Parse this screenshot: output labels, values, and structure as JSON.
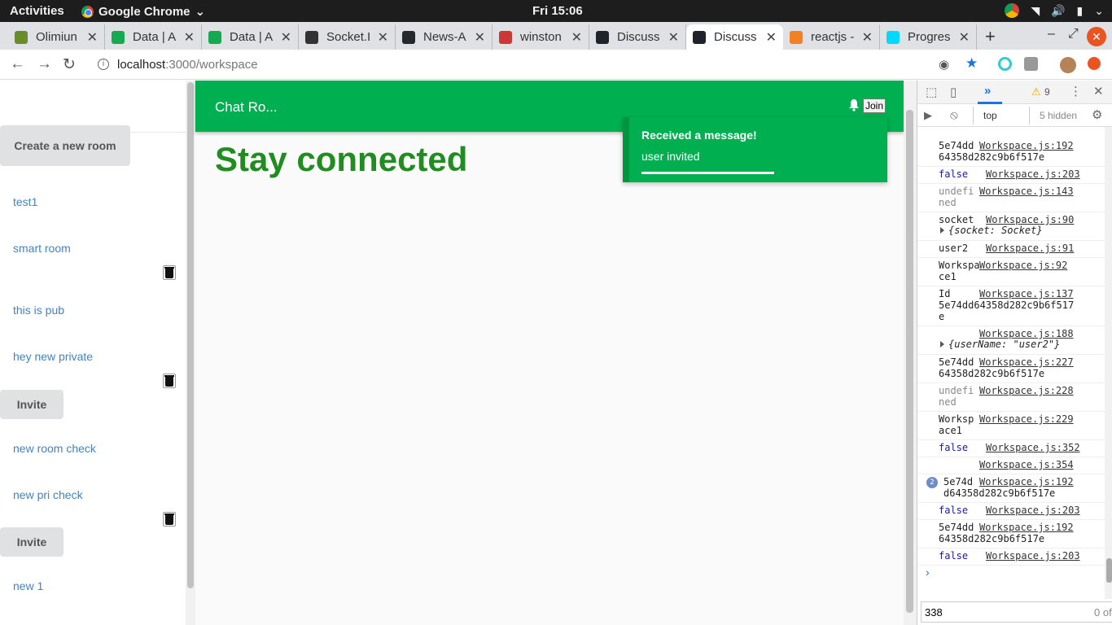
{
  "os_bar": {
    "activities": "Activities",
    "app_name": "Google Chrome",
    "clock": "Fri 15:06"
  },
  "tabs": [
    {
      "title": "Olimiun",
      "color": "#6a8c2b"
    },
    {
      "title": "Data | A",
      "color": "#13aa52"
    },
    {
      "title": "Data | A",
      "color": "#13aa52"
    },
    {
      "title": "Socket.I",
      "color": "#333333"
    },
    {
      "title": "News-A",
      "color": "#24292e"
    },
    {
      "title": "winston",
      "color": "#cb3837"
    },
    {
      "title": "Discuss",
      "color": "#20232a"
    },
    {
      "title": "Discuss",
      "color": "#20232a",
      "active": true
    },
    {
      "title": "reactjs -",
      "color": "#f48024"
    },
    {
      "title": "Progres",
      "color": "#00d8ff"
    }
  ],
  "address": {
    "host": "localhost",
    "path": ":3000/workspace"
  },
  "sidebar": {
    "create_button": "Create a new room",
    "rooms": [
      {
        "name": "test1"
      },
      {
        "name": "smart room"
      },
      {
        "name": "this is pub"
      },
      {
        "name": "hey new private"
      },
      {
        "name": "new room check"
      },
      {
        "name": "new pri check"
      },
      {
        "name": "new 1"
      }
    ],
    "invite_label": "Invite"
  },
  "header": {
    "title": "Chat Ro...",
    "join_label": "Join"
  },
  "main": {
    "headline": "Stay connected"
  },
  "toast": {
    "title": "Received a message!",
    "body": "user invited"
  },
  "devtools": {
    "warnings": "9",
    "context": "top",
    "hidden": "5 hidden",
    "search_value": "338",
    "search_result": "0 of",
    "logs": [
      {
        "msg": "5e74dd\n64358d282c9b6f517e",
        "src": "Workspace.js:192"
      },
      {
        "msg": "false",
        "src": "Workspace.js:203",
        "kw": true
      },
      {
        "msg": "undefi\nned",
        "src": "Workspace.js:143",
        "gray": true
      },
      {
        "msg": "socket",
        "src": "Workspace.js:90",
        "sub": "{socket: Socket}"
      },
      {
        "msg": "user2",
        "src": "Workspace.js:91"
      },
      {
        "msg": "Workspa\nce1",
        "src": "Workspace.js:92"
      },
      {
        "msg": "Id\n5e74dd64358d282c9b6f517\ne",
        "src": "Workspace.js:137"
      },
      {
        "msg": "",
        "src": "Workspace.js:188",
        "sub": "{userName: \"user2\"}"
      },
      {
        "msg": "5e74dd\n64358d282c9b6f517e",
        "src": "Workspace.js:227"
      },
      {
        "msg": "undefi\nned",
        "src": "Workspace.js:228",
        "gray": true
      },
      {
        "msg": "Worksp\nace1",
        "src": "Workspace.js:229"
      },
      {
        "msg": "false",
        "src": "Workspace.js:352",
        "kw": true
      },
      {
        "msg": "",
        "src": "Workspace.js:354"
      },
      {
        "msg": "5e74d\nd64358d282c9b6f517e",
        "src": "Workspace.js:192",
        "badge": "2"
      },
      {
        "msg": "false",
        "src": "Workspace.js:203",
        "kw": true
      },
      {
        "msg": "5e74dd\n64358d282c9b6f517e",
        "src": "Workspace.js:192"
      },
      {
        "msg": "false",
        "src": "Workspace.js:203",
        "kw": true
      }
    ]
  }
}
